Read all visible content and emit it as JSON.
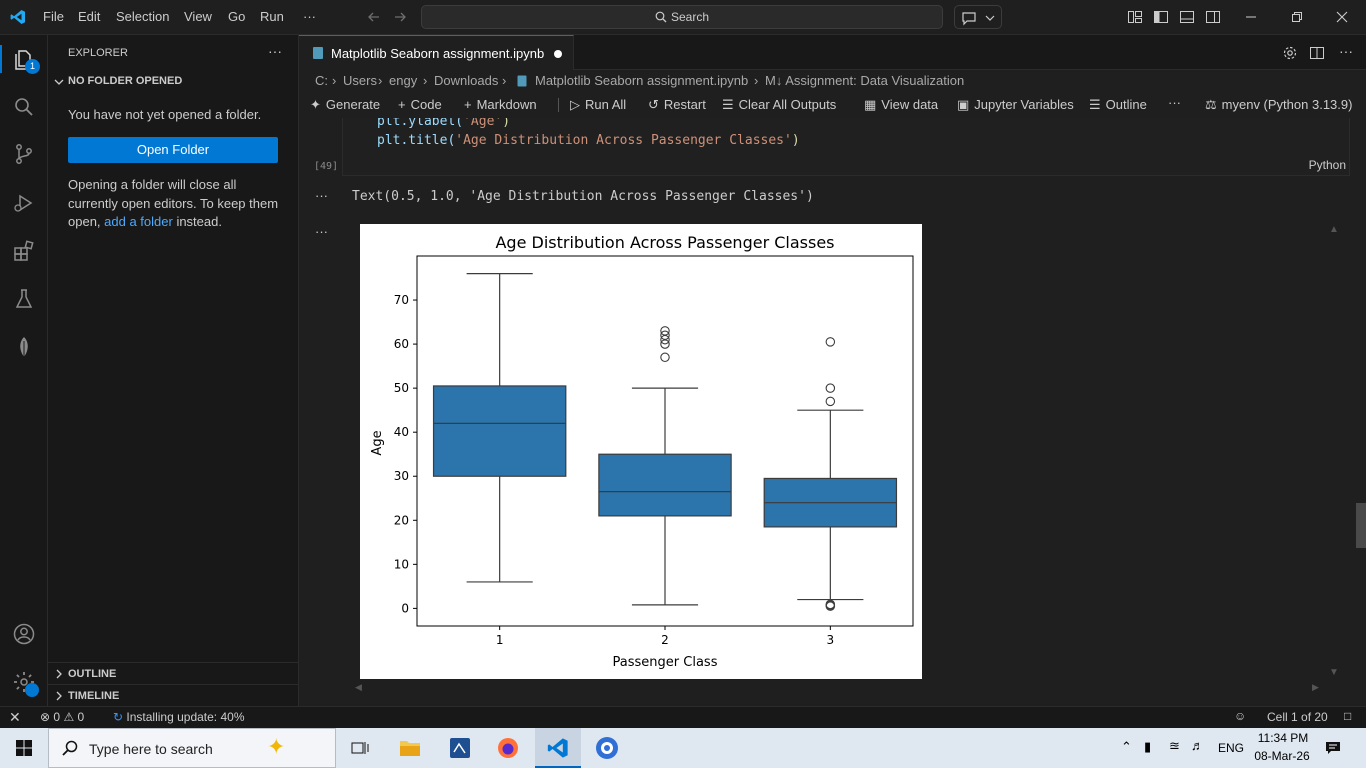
{
  "titlebar": {
    "menu": [
      "File",
      "Edit",
      "Selection",
      "View",
      "Go",
      "Run",
      "···"
    ],
    "search_placeholder": "Search"
  },
  "activity": {
    "explorer_badge": "1"
  },
  "sidebar": {
    "title": "EXPLORER",
    "section": "NO FOLDER OPENED",
    "message": "You have not yet opened a folder.",
    "open_folder": "Open Folder",
    "hint_before": "Opening a folder will close all currently open editors. To keep them open, ",
    "hint_link": "add a folder",
    "hint_after": " instead.",
    "outline": "OUTLINE",
    "timeline": "TIMELINE"
  },
  "tab": {
    "title": "Matplotlib Seaborn assignment.ipynb"
  },
  "breadcrumb": [
    "C:",
    "Users",
    "engy",
    "Downloads",
    "Matplotlib Seaborn assignment.ipynb",
    "M↓ Assignment: Data Visualization"
  ],
  "nbtoolbar": {
    "generate": "Generate",
    "code": "Code",
    "markdown": "Markdown",
    "run_all": "Run All",
    "restart": "Restart",
    "clear": "Clear All Outputs",
    "view_data": "View data",
    "variables": "Jupyter Variables",
    "outline": "Outline",
    "more": "···",
    "kernel": "myenv (Python 3.13.9)"
  },
  "cell": {
    "code_line1_fn": "plt.ylabel(",
    "code_line1_arg": "'Age'",
    "code_line1_end": ")",
    "code_line2_fn": "plt.title(",
    "code_line2_arg": "'Age Distribution Across Passenger Classes'",
    "code_line2_end": ")",
    "exec_count": "[49]",
    "language": "Python",
    "output_text": "Text(0.5, 1.0, 'Age Distribution Across Passenger Classes')",
    "ellipsis": "···"
  },
  "chart_data": {
    "type": "box",
    "title": "Age Distribution Across Passenger Classes",
    "xlabel": "Passenger Class",
    "ylabel": "Age",
    "categories": [
      "1",
      "2",
      "3"
    ],
    "ylim": [
      -4,
      80
    ],
    "yticks": [
      0,
      10,
      20,
      30,
      40,
      50,
      60,
      70
    ],
    "color": "#2b74ac",
    "boxes": [
      {
        "category": "1",
        "whisker_low": 6,
        "q1": 30,
        "median": 42,
        "q3": 50.5,
        "whisker_high": 76,
        "outliers": []
      },
      {
        "category": "2",
        "whisker_low": 0.8,
        "q1": 21,
        "median": 26.5,
        "q3": 35,
        "whisker_high": 50,
        "outliers": [
          57,
          60,
          61,
          62,
          63
        ]
      },
      {
        "category": "3",
        "whisker_low": 2,
        "q1": 18.5,
        "median": 24,
        "q3": 29.5,
        "whisker_high": 45,
        "outliers": [
          0.5,
          0.7,
          0.9,
          47,
          50,
          60.5
        ]
      }
    ]
  },
  "statusbar": {
    "errors": "0",
    "warnings": "0",
    "update": "Installing update: 40%",
    "cell_pos": "Cell 1 of 20"
  },
  "taskbar": {
    "search_placeholder": "Type here to search",
    "lang": "ENG",
    "time": "11:34 PM",
    "date": "08-Mar-26"
  }
}
